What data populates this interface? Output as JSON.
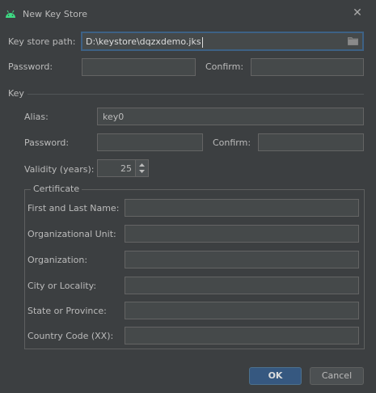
{
  "window": {
    "title": "New Key Store",
    "close_icon": "close-icon",
    "app_icon": "android-icon",
    "accent": "#3d6185"
  },
  "keystore": {
    "path_label": "Key store path:",
    "path_value": "D:\\keystore\\dqzxdemo.jks",
    "password_label": "Password:",
    "password_value": "",
    "confirm_label": "Confirm:",
    "confirm_value": ""
  },
  "key": {
    "section_label": "Key",
    "alias_label": "Alias:",
    "alias_value": "key0",
    "password_label": "Password:",
    "password_value": "",
    "confirm_label": "Confirm:",
    "confirm_value": "",
    "validity_label": "Validity (years):",
    "validity_value": "25"
  },
  "certificate": {
    "legend": "Certificate",
    "fields": [
      {
        "label": "First and Last Name:",
        "value": ""
      },
      {
        "label": "Organizational Unit:",
        "value": ""
      },
      {
        "label": "Organization:",
        "value": ""
      },
      {
        "label": "City or Locality:",
        "value": ""
      },
      {
        "label": "State or Province:",
        "value": ""
      },
      {
        "label": "Country Code (XX):",
        "value": ""
      }
    ]
  },
  "buttons": {
    "ok": "OK",
    "cancel": "Cancel"
  }
}
